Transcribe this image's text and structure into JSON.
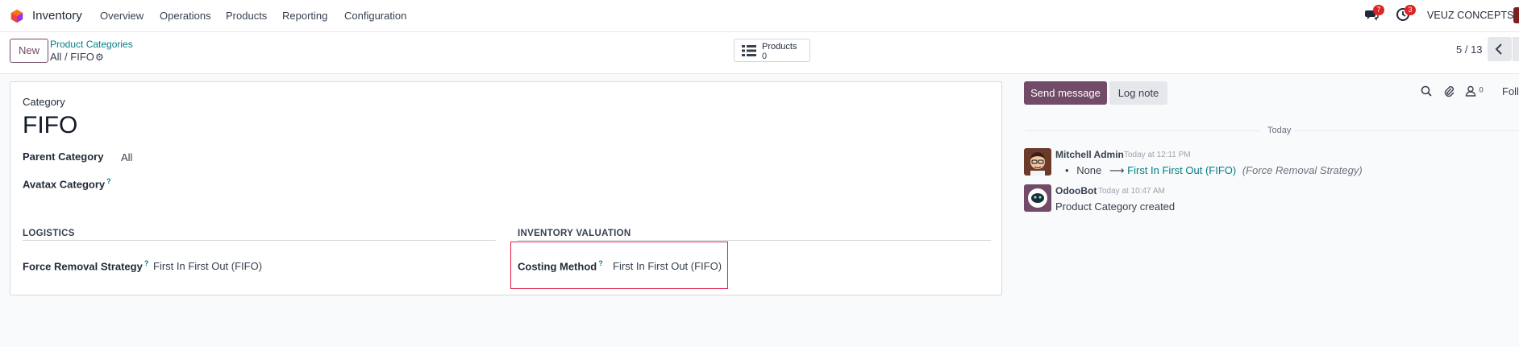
{
  "navbar": {
    "app_name": "Inventory",
    "menu": [
      "Overview",
      "Operations",
      "Products",
      "Reporting",
      "Configuration"
    ],
    "messages_count": "7",
    "activities_count": "3",
    "company": "VEUZ CONCEPTS"
  },
  "control": {
    "new_label": "New",
    "breadcrumb_parent": "Product Categories",
    "breadcrumb_current": "All / FIFO",
    "smart_button": {
      "label": "Products",
      "count": "0"
    },
    "pager": "5 / 13"
  },
  "form": {
    "category_label": "Category",
    "category_name": "FIFO",
    "parent_label": "Parent Category",
    "parent_value": "All",
    "avatax_label": "Avatax Category",
    "help_mark": "?",
    "logistics_title": "LOGISTICS",
    "removal_label": "Force Removal Strategy",
    "removal_value": "First In First Out (FIFO)",
    "valuation_title": "INVENTORY VALUATION",
    "costing_label": "Costing Method",
    "costing_value": "First In First Out (FIFO)"
  },
  "chatter": {
    "send_label": "Send message",
    "log_label": "Log note",
    "followers_count": "0",
    "follow_label": "Foll",
    "day_label": "Today",
    "messages": [
      {
        "author": "Mitchell Admin",
        "time": "Today at 12:11 PM",
        "old_value": "None",
        "arrow": "⟶",
        "new_value": "First In First Out (FIFO)",
        "field": "(Force Removal Strategy)"
      },
      {
        "author": "OdooBot",
        "time": "Today at 10:47 AM",
        "body": "Product Category created"
      }
    ]
  }
}
